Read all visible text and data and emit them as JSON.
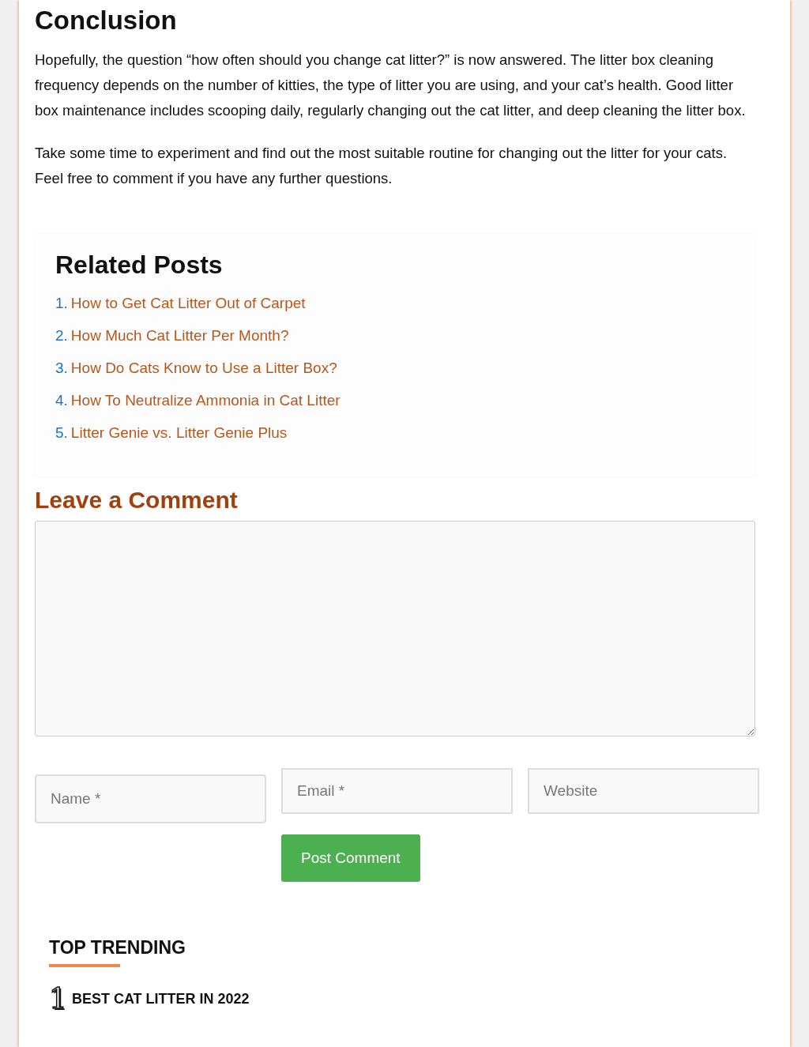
{
  "article": {
    "heading": "Conclusion",
    "paragraphs": [
      "Hopefully, the question “how often should you change cat litter?” is now answered. The litter box cleaning frequency depends on the number of kitties, the type of litter you are using, and your cat’s health. Good litter box maintenance includes scooping daily, regularly changing out the cat litter, and deep cleaning the litter box.",
      "Take some time to experiment and find out the most suitable routine for changing out the litter for your cats. Feel free to comment if you have any further questions."
    ]
  },
  "related_posts": {
    "title": "Related Posts",
    "items": [
      {
        "number": "1.",
        "title": "How to Get Cat Litter Out of Carpet"
      },
      {
        "number": "2.",
        "title": "How Much Cat Litter Per Month?"
      },
      {
        "number": "3.",
        "title": "How Do Cats Know to Use a Litter Box?"
      },
      {
        "number": "4.",
        "title": "How To Neutralize Ammonia in Cat Litter"
      },
      {
        "number": "5.",
        "title": "Litter Genie vs. Litter Genie Plus"
      }
    ]
  },
  "comment_form": {
    "title": "Leave a Comment",
    "fields": [
      {
        "placeholder": "Name *"
      },
      {
        "placeholder": "Email *"
      },
      {
        "placeholder": "Website"
      }
    ],
    "submit": "Post Comment"
  },
  "top_trending": {
    "title": "TOP TRENDING",
    "items": [
      {
        "rank": "1",
        "title": "BEST CAT LITTER IN 2022"
      }
    ]
  }
}
